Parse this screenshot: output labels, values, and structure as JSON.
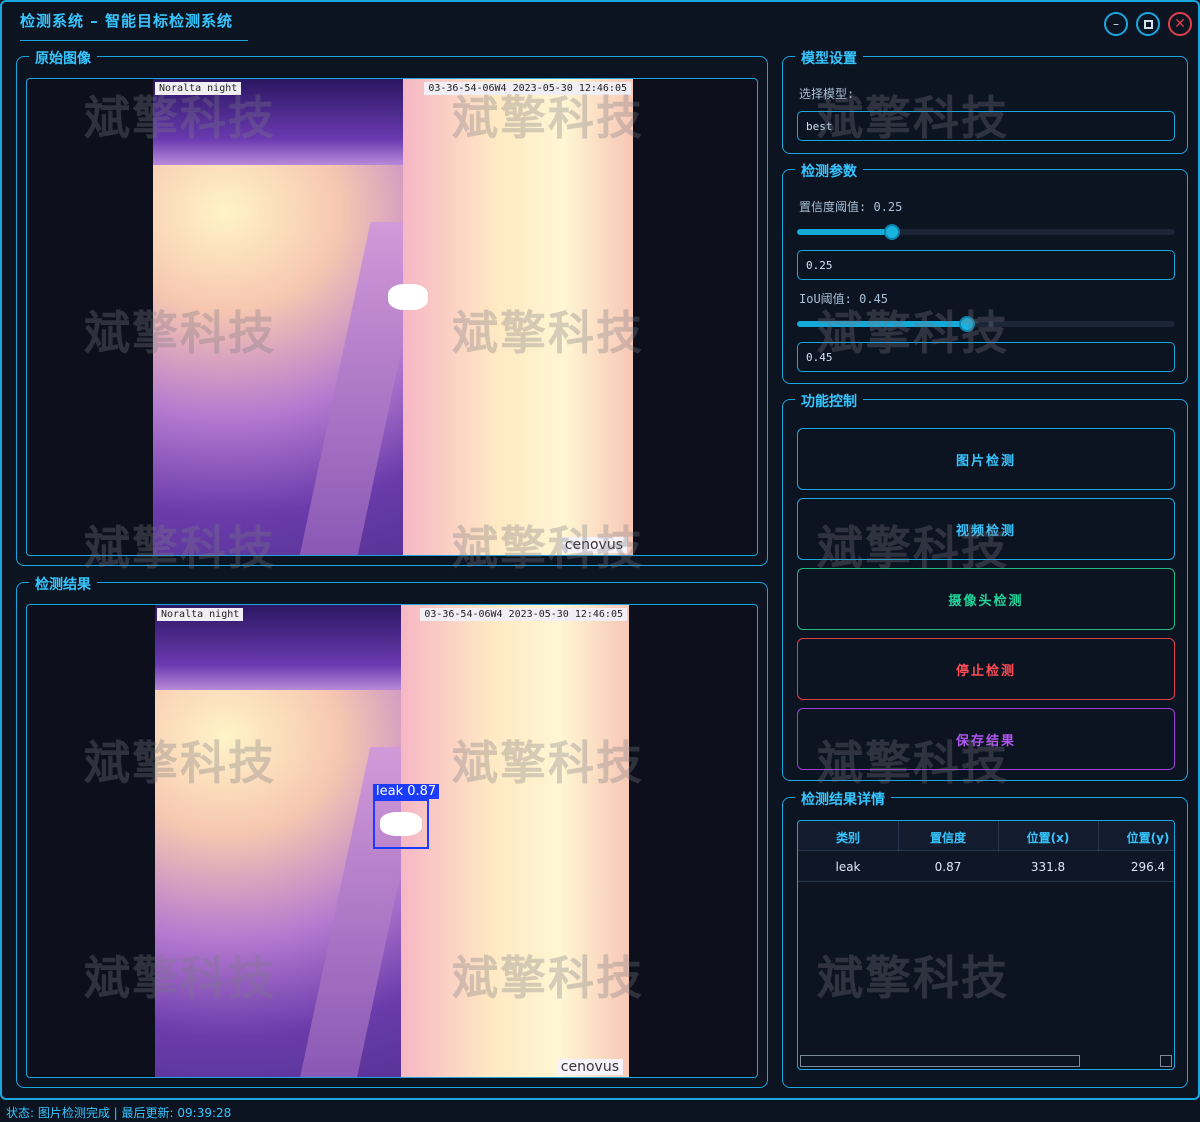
{
  "window": {
    "title": "检测系统 – 智能目标检测系统"
  },
  "panels": {
    "original": {
      "title": "原始图像"
    },
    "result": {
      "title": "检测结果"
    },
    "model": {
      "title": "模型设置",
      "select_label": "选择模型:",
      "select_value": "best"
    },
    "params": {
      "title": "检测参数",
      "conf_label": "置信度阈值: 0.25",
      "conf_value": "0.25",
      "conf_level": 0.25,
      "iou_label": "IoU阈值: 0.45",
      "iou_value": "0.45",
      "iou_level": 0.45
    },
    "controls": {
      "title": "功能控制",
      "image_btn": "图片检测",
      "video_btn": "视频检测",
      "camera_btn": "摄像头检测",
      "stop_btn": "停止检测",
      "save_btn": "保存结果"
    },
    "details": {
      "title": "检测结果详情",
      "columns": [
        "类别",
        "置信度",
        "位置(x)",
        "位置(y)"
      ],
      "rows": [
        [
          "leak",
          "0.87",
          "331.8",
          "296.4"
        ]
      ]
    }
  },
  "image": {
    "stamp_left": "Noralta night",
    "stamp_right": "03-36-54-06W4 2023-05-30 12:46:05",
    "logo": "cenovus",
    "detection_label": "leak  0.87"
  },
  "watermark": "斌擎科技",
  "colors": {
    "accent": "#1aa6df",
    "video": "#1aa6df",
    "camera": "#1fb985",
    "stop": "#e0404a",
    "save": "#9b3fd6",
    "bbox": "#1b3cff"
  },
  "status": "状态: 图片检测完成 | 最后更新: 09:39:28"
}
